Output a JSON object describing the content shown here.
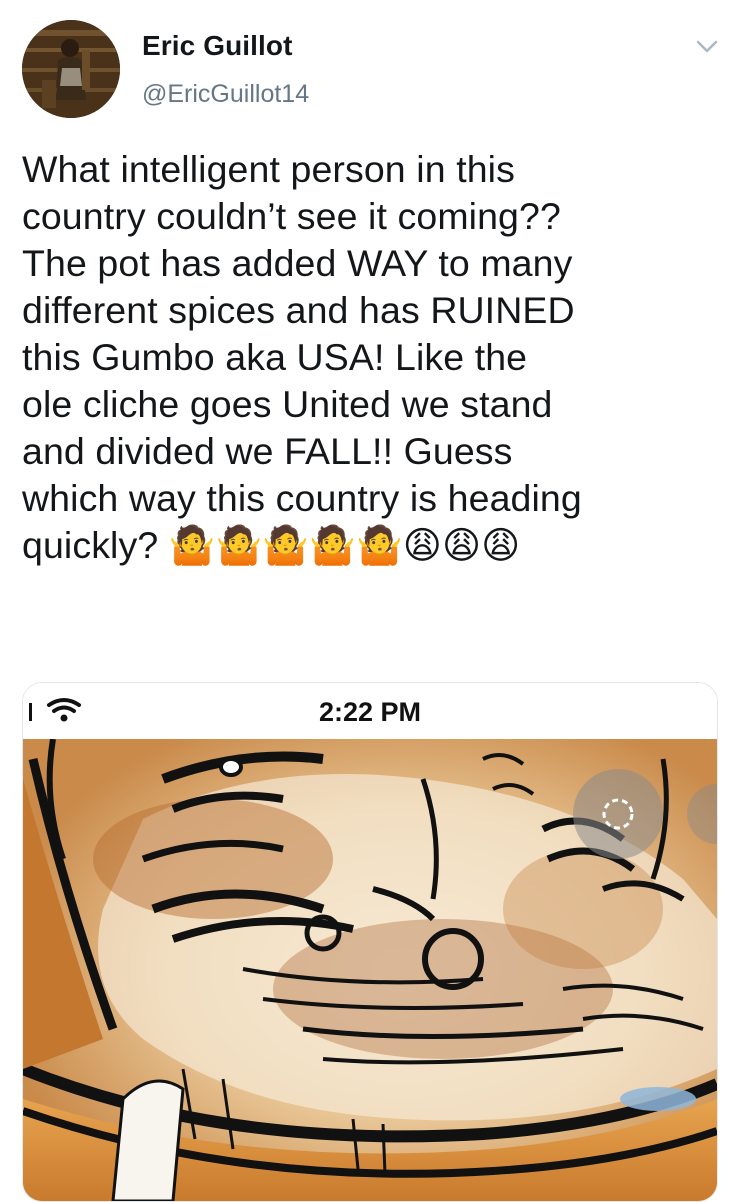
{
  "tweet": {
    "author": {
      "display_name": "Eric Guillot",
      "handle": "@EricGuillot14"
    },
    "text": "What intelligent person in this\ncountry couldn’t see it coming??\nThe pot has added WAY to many\ndifferent spices and has RUINED\nthis Gumbo aka USA! Like the\nole cliche goes United we stand\nand divided we FALL!! Guess\nwhich way this country is heading\nquickly? 🤷🤷🤷🤷🤷😩😩😩",
    "menu_icon": "chevron-down-icon"
  },
  "media": {
    "status_bar": {
      "time": "2:22 PM",
      "signal_icon": "wifi-icon"
    }
  },
  "colors": {
    "text": "#14171a",
    "secondary": "#657786",
    "border": "#e1e8ed"
  }
}
